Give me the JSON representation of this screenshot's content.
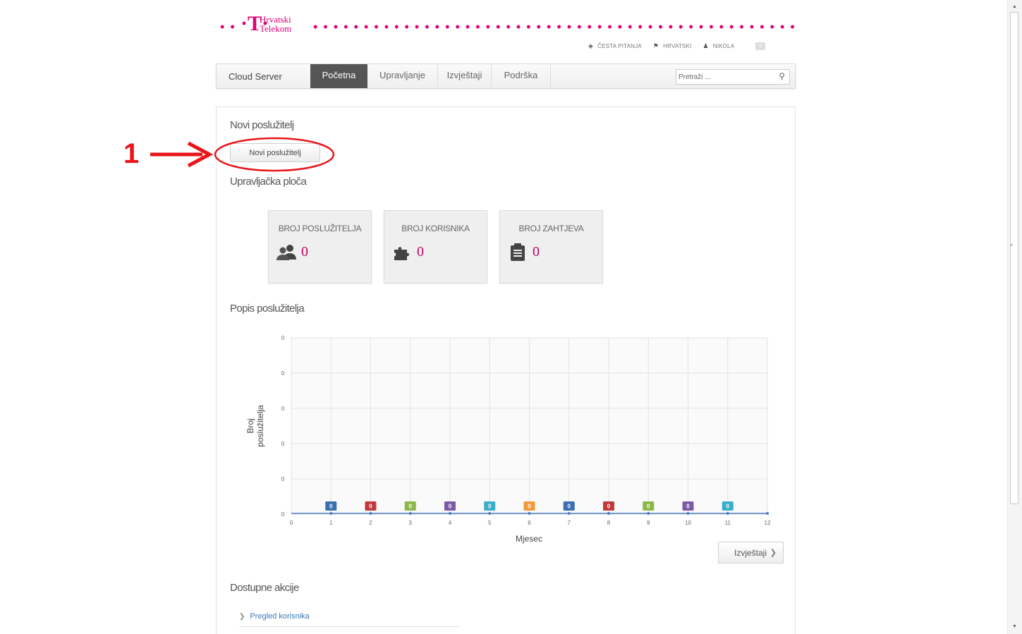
{
  "header": {
    "logo_text_line1": "Hrvatski",
    "logo_text_line2": "Telekom",
    "util": {
      "faq": "ČESTA PITANJA",
      "language": "HRVATSKI",
      "user": "NIKOLA",
      "badge": "0"
    }
  },
  "nav": {
    "brand": "Cloud Server",
    "tabs": [
      "Početna",
      "Upravljanje",
      "Izvještaji",
      "Podrška"
    ],
    "active_tab": "Početna",
    "search_placeholder": "Pretraži ..."
  },
  "main": {
    "new_server_title": "Novi poslužitelj",
    "new_server_button": "Novi poslužitelj",
    "dashboard_title": "Upravljačka ploča",
    "stats": [
      {
        "label": "BROJ POSLUŽITELJA",
        "value": "0",
        "icon": "users-icon"
      },
      {
        "label": "BROJ KORISNIKA",
        "value": "0",
        "icon": "puzzle-icon"
      },
      {
        "label": "BROJ ZAHTJEVA",
        "value": "0",
        "icon": "clipboard-icon"
      }
    ],
    "server_list_title": "Popis poslužitelja",
    "reports_button": "Izvještaji",
    "actions_title": "Dostupne akcije",
    "actions": [
      "Pregled korisnika"
    ]
  },
  "annotation": {
    "number": "1"
  },
  "colors": {
    "brand": "#e20074",
    "annotation": "#e8151b"
  },
  "chart_data": {
    "type": "line",
    "xlabel": "Mjesec",
    "ylabel": "Broj poslužitelja",
    "x_ticks": [
      "0",
      "1",
      "2",
      "3",
      "4",
      "5",
      "6",
      "7",
      "8",
      "9",
      "10",
      "11",
      "12"
    ],
    "y_ticks": [
      "0",
      "0",
      "0",
      "0",
      "0",
      "0"
    ],
    "xlim": [
      0,
      12
    ],
    "ylim": [
      0,
      0
    ],
    "grid": true,
    "series": [
      {
        "values": [
          0,
          0,
          0,
          0,
          0,
          0,
          0,
          0,
          0,
          0,
          0,
          0,
          0
        ]
      }
    ],
    "point_labels": [
      {
        "x": 1,
        "value": "0",
        "color": "#3b6fb0"
      },
      {
        "x": 2,
        "value": "0",
        "color": "#c0393b"
      },
      {
        "x": 3,
        "value": "0",
        "color": "#8cb84a"
      },
      {
        "x": 4,
        "value": "0",
        "color": "#7d5aa6"
      },
      {
        "x": 5,
        "value": "0",
        "color": "#3aaecb"
      },
      {
        "x": 6,
        "value": "0",
        "color": "#f29a3b"
      },
      {
        "x": 7,
        "value": "0",
        "color": "#3b6fb0"
      },
      {
        "x": 8,
        "value": "0",
        "color": "#c0393b"
      },
      {
        "x": 9,
        "value": "0",
        "color": "#8cb84a"
      },
      {
        "x": 10,
        "value": "0",
        "color": "#7d5aa6"
      },
      {
        "x": 11,
        "value": "0",
        "color": "#3aaecb"
      }
    ]
  }
}
